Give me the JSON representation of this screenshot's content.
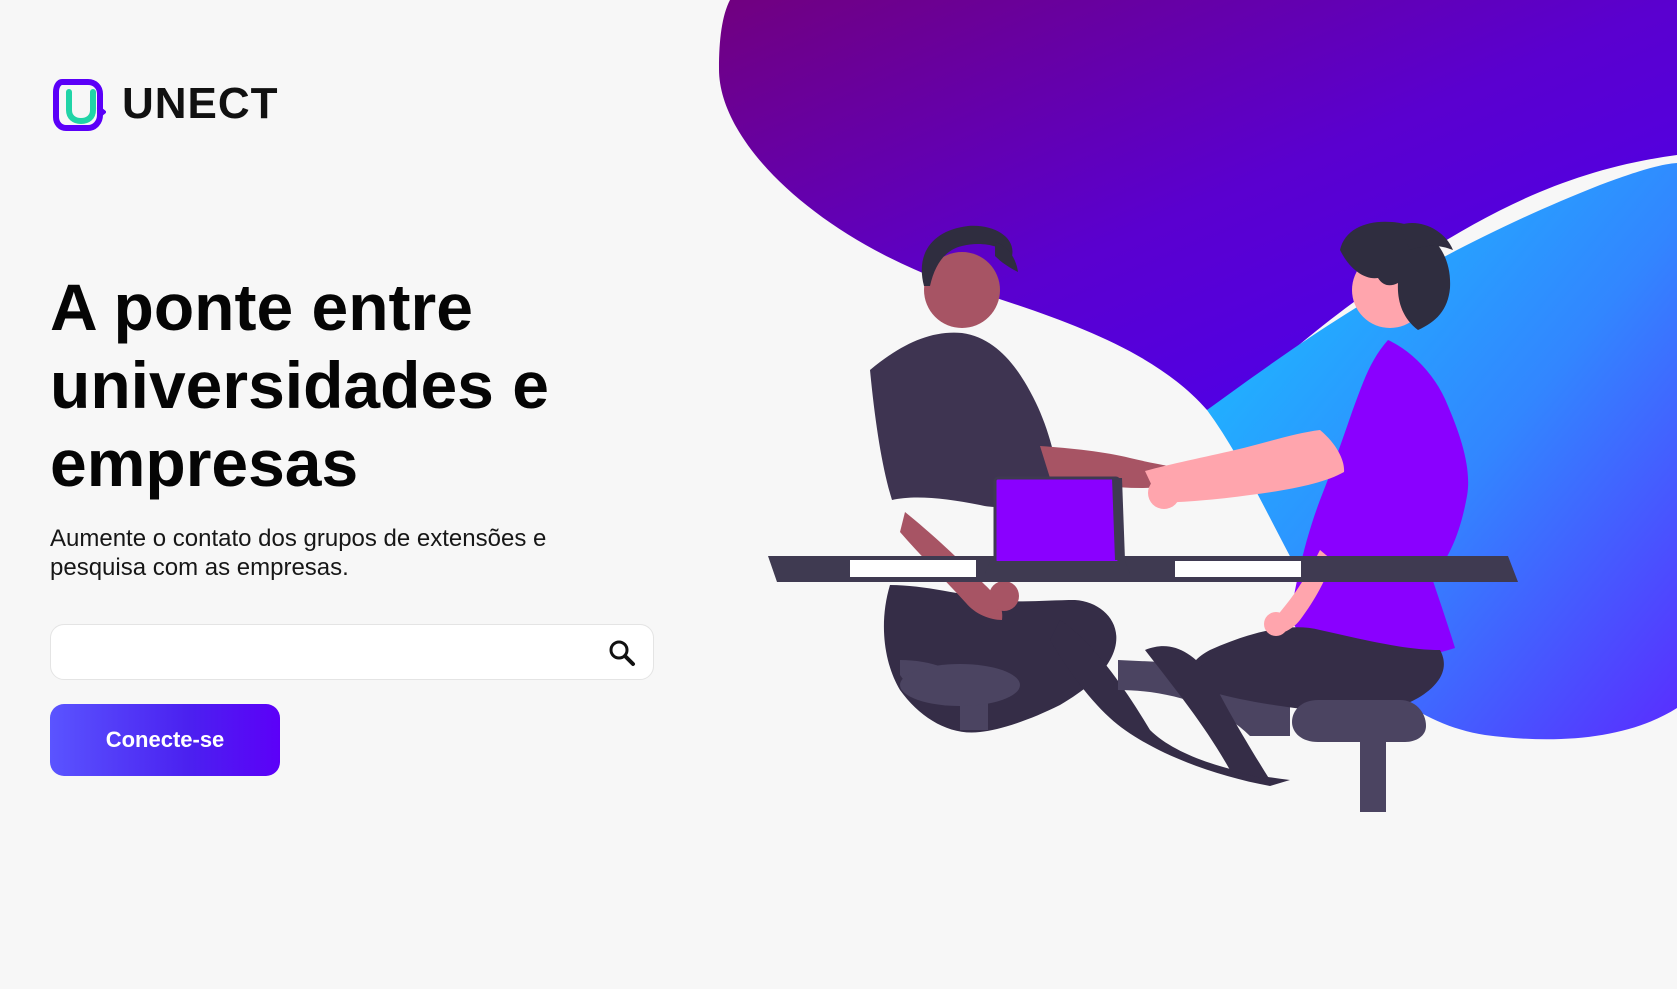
{
  "brand": {
    "logo_icon": "unect-logo-icon",
    "name": "UNECT",
    "primary_color": "#5b00f8",
    "accent_color": "#20d4a7"
  },
  "hero": {
    "headline": "A ponte entre universidades e empresas",
    "subtitle": "Aumente o contato dos grupos de extensões e pesquisa com as empresas."
  },
  "search": {
    "value": "",
    "placeholder": "",
    "icon": "search-icon"
  },
  "actions": {
    "connect_label": "Conecte-se"
  }
}
